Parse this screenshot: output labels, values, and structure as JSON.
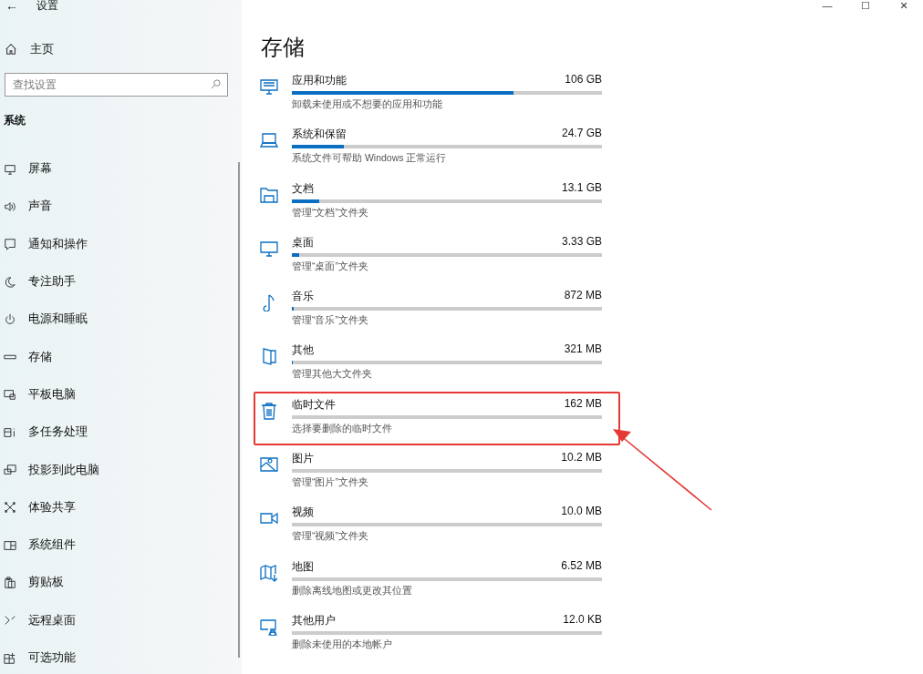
{
  "window": {
    "title": "设置",
    "back": "←",
    "controls": [
      "—",
      "☐",
      "✕"
    ]
  },
  "sidebar": {
    "home": "主页",
    "search": {
      "placeholder": "查找设置"
    },
    "section": "系统",
    "items": [
      {
        "label": "屏幕",
        "kind": "display"
      },
      {
        "label": "声音",
        "kind": "sound"
      },
      {
        "label": "通知和操作",
        "kind": "notify"
      },
      {
        "label": "专注助手",
        "kind": "focus"
      },
      {
        "label": "电源和睡眠",
        "kind": "power"
      },
      {
        "label": "存储",
        "kind": "storage"
      },
      {
        "label": "平板电脑",
        "kind": "tablet"
      },
      {
        "label": "多任务处理",
        "kind": "multitask"
      },
      {
        "label": "投影到此电脑",
        "kind": "project"
      },
      {
        "label": "体验共享",
        "kind": "share"
      },
      {
        "label": "系统组件",
        "kind": "components"
      },
      {
        "label": "剪贴板",
        "kind": "clipboard"
      },
      {
        "label": "远程桌面",
        "kind": "remote"
      },
      {
        "label": "可选功能",
        "kind": "optional"
      }
    ]
  },
  "main": {
    "title": "存储",
    "categories": [
      {
        "name": "应用和功能",
        "size": "106 GB",
        "level": 0.716,
        "description": "卸载未使用或不想要的应用和功能",
        "kind": "apps",
        "highlighted": false
      },
      {
        "name": "系统和保留",
        "size": "24.7 GB",
        "level": 0.167,
        "description": "系统文件可帮助 Windows 正常运行",
        "kind": "system",
        "highlighted": false
      },
      {
        "name": "文档",
        "size": "13.1 GB",
        "level": 0.088,
        "description": "管理“文档”文件夹",
        "kind": "documents",
        "highlighted": false
      },
      {
        "name": "桌面",
        "size": "3.33 GB",
        "level": 0.023,
        "description": "管理“桌面”文件夹",
        "kind": "desktop",
        "highlighted": false
      },
      {
        "name": "音乐",
        "size": "872 MB",
        "level": 0.005,
        "description": "管理“音乐”文件夹",
        "kind": "music",
        "highlighted": false
      },
      {
        "name": "其他",
        "size": "321 MB",
        "level": 0.003,
        "description": "管理其他大文件夹",
        "kind": "other",
        "highlighted": false
      },
      {
        "name": "临时文件",
        "size": "162 MB",
        "description": "选择要删除的临时文件",
        "kind": "temp",
        "highlighted": true
      },
      {
        "name": "图片",
        "size": "10.2 MB",
        "description": "管理“图片”文件夹",
        "kind": "pictures",
        "highlighted": false
      },
      {
        "name": "视频",
        "size": "10.0 MB",
        "description": "管理“视频”文件夹",
        "kind": "videos",
        "highlighted": false
      },
      {
        "name": "地图",
        "size": "6.52 MB",
        "description": "删除离线地图或更改其位置",
        "kind": "maps",
        "highlighted": false
      },
      {
        "name": "其他用户",
        "size": "12.0 KB",
        "description": "删除未使用的本地帐户",
        "kind": "users",
        "highlighted": false
      }
    ]
  }
}
